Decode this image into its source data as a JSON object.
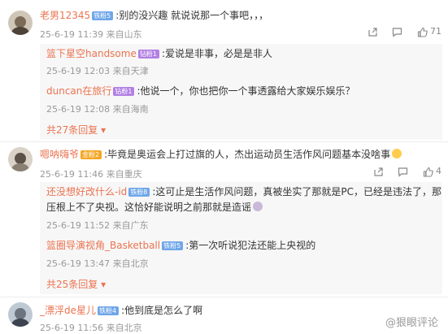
{
  "comments": [
    {
      "user": "老男12345",
      "badge": "铁粉5",
      "badge_color": "#6fa6e8",
      "text": ":别的没兴趣 就说说那一个事吧，，，",
      "date": "25-6-19 11:39",
      "loc": "来自山东",
      "likes": "71",
      "replies": [
        {
          "user": "篮下星空handsome",
          "badge": "钻粉1",
          "badge_color": "#b27fe3",
          "text": ":爱说是非事，必是是非人",
          "date": "25-6-19 12:03",
          "loc": "来自天津"
        },
        {
          "user": "duncan在旅行",
          "badge": "钻粉1",
          "badge_color": "#b27fe3",
          "text": ":他说一个，你也把你一个事透露给大家娱乐娱乐？",
          "date": "25-6-19 12:08",
          "loc": "来自海南"
        }
      ],
      "more": "共27条回复"
    },
    {
      "user": "嗯呐嗨爷",
      "badge": "金粉2",
      "badge_color": "#f5a623",
      "text": ":毕竟是奥运会上打过旗的人，杰出运动员生活作风问题基本没啥事",
      "date": "25-6-19 11:46",
      "loc": "来自重庆",
      "likes": "4",
      "replies": [
        {
          "user": "还没想好改什么-id",
          "badge": "铁粉8",
          "badge_color": "#6fa6e8",
          "text": ":这可止是生活作风问题，真被坐实了那就是PC，已经是违法了，那",
          "text2": "压根上不了央视。这恰好能说明之前那就是造谣",
          "date": "25-6-19 11:52",
          "loc": "来自广东"
        },
        {
          "user": "篮圈导演视角_Basketball",
          "badge": "铁粉5",
          "badge_color": "#6fa6e8",
          "text": ":第一次听说犯法还能上央视的",
          "date": "25-6-19 13:47",
          "loc": "来自北京"
        }
      ],
      "more": "共25条回复"
    },
    {
      "user": "_漂浮de星儿",
      "badge": "铁粉4",
      "badge_color": "#6fa6e8",
      "text": ":他到底是怎么了啊",
      "date": "25-6-19 11:56",
      "loc": "来自北京",
      "likes": ""
    }
  ],
  "watermark": "@狠眼评论"
}
